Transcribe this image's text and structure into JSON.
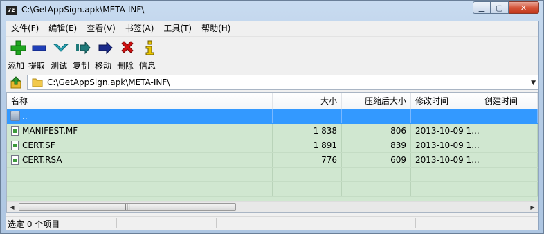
{
  "window": {
    "title": "C:\\GetAppSign.apk\\META-INF\\",
    "app_icon_text": "7z",
    "controls": {
      "minimize": "▁",
      "maximize": "▢",
      "close": "✕"
    }
  },
  "menu": [
    "文件(F)",
    "编辑(E)",
    "查看(V)",
    "书签(A)",
    "工具(T)",
    "帮助(H)"
  ],
  "toolbar": [
    {
      "label": "添加",
      "icon": "plus-icon",
      "color": "#1fa51f"
    },
    {
      "label": "提取",
      "icon": "minus-icon",
      "color": "#1f3fb8"
    },
    {
      "label": "测试",
      "icon": "check-chevron-icon",
      "color": "#2aa7b8"
    },
    {
      "label": "复制",
      "icon": "copy-arrow-icon",
      "color": "#1f7a7a"
    },
    {
      "label": "移动",
      "icon": "move-arrow-icon",
      "color": "#1a2a8a"
    },
    {
      "label": "删除",
      "icon": "delete-x-icon",
      "color": "#d01010"
    },
    {
      "label": "信息",
      "icon": "info-icon",
      "color": "#d4b400"
    }
  ],
  "address": {
    "path": "C:\\GetAppSign.apk\\META-INF\\"
  },
  "columns": [
    "名称",
    "大小",
    "压缩后大小",
    "修改时间",
    "创建时间"
  ],
  "rows": [
    {
      "name": "..",
      "size": "",
      "packed": "",
      "modified": "",
      "created": "",
      "type": "parent",
      "selected": true
    },
    {
      "name": "MANIFEST.MF",
      "size": "1 838",
      "packed": "806",
      "modified": "2013-10-09 1...",
      "created": "",
      "type": "file",
      "selected": false
    },
    {
      "name": "CERT.SF",
      "size": "1 891",
      "packed": "839",
      "modified": "2013-10-09 1...",
      "created": "",
      "type": "file",
      "selected": false
    },
    {
      "name": "CERT.RSA",
      "size": "776",
      "packed": "609",
      "modified": "2013-10-09 1...",
      "created": "",
      "type": "file",
      "selected": false
    }
  ],
  "scrollbar": {
    "left_arrow": "◀",
    "right_arrow": "▶",
    "grip": "|||"
  },
  "status": {
    "text": "选定 0 个项目"
  },
  "colors": {
    "row_bg": "#d0e7d0",
    "selected_bg": "#3399ff",
    "title_bg": "#b7cde6"
  }
}
